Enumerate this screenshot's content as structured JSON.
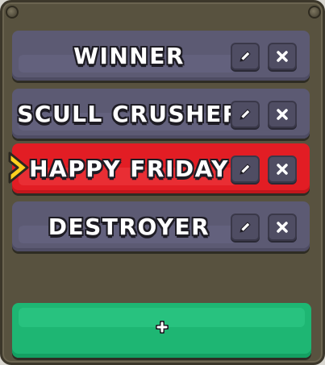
{
  "teams": [
    {
      "name": "Winner",
      "selected": false
    },
    {
      "name": "Scull Crusher",
      "selected": false
    },
    {
      "name": "Happy Friday",
      "selected": true
    },
    {
      "name": "Destroyer",
      "selected": false
    }
  ],
  "add_button": {
    "label": "+"
  },
  "icons": {
    "edit": "pencil-icon",
    "delete": "close-icon",
    "selected_marker": "chevron-right-icon"
  },
  "colors": {
    "row": "#5c5a73",
    "selected_row": "#e21d24",
    "add_button": "#1eb673",
    "selector": "#ffd21f",
    "frame": "#58523f"
  }
}
